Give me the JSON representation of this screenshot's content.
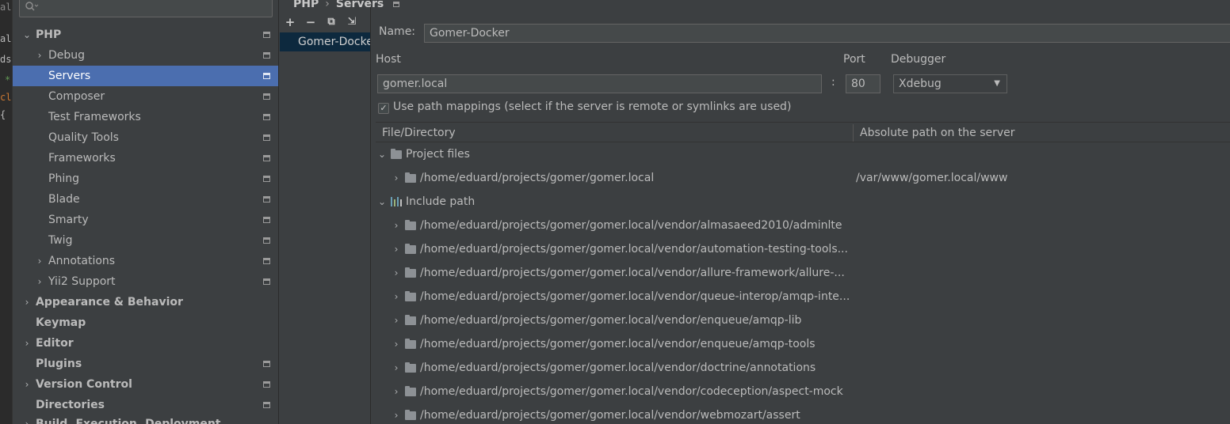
{
  "editor_strip": {
    "fragments": [
      "al",
      "ds",
      "*",
      "cl",
      "{"
    ]
  },
  "settings_tree": {
    "search_placeholder": "",
    "items": [
      {
        "label": "PHP",
        "bold": true,
        "expanded": true
      },
      {
        "label": "Debug"
      },
      {
        "label": "Servers",
        "selected": true
      },
      {
        "label": "Composer"
      },
      {
        "label": "Test Frameworks"
      },
      {
        "label": "Quality Tools"
      },
      {
        "label": "Frameworks"
      },
      {
        "label": "Phing"
      },
      {
        "label": "Blade"
      },
      {
        "label": "Smarty"
      },
      {
        "label": "Twig"
      },
      {
        "label": "Annotations"
      },
      {
        "label": "Yii2 Support"
      },
      {
        "label": "Appearance & Behavior",
        "bold": true
      },
      {
        "label": "Keymap",
        "bold": true
      },
      {
        "label": "Editor",
        "bold": true
      },
      {
        "label": "Plugins",
        "bold": true
      },
      {
        "label": "Version Control",
        "bold": true
      },
      {
        "label": "Directories",
        "bold": true
      },
      {
        "label": "Build, Execution, Deployment",
        "bold": true
      }
    ]
  },
  "breadcrumb": {
    "parent": "PHP",
    "separator": "›",
    "current": "Servers"
  },
  "servers_toolbar": {
    "add": "+",
    "remove": "−",
    "copy": "⧉",
    "import": "⇲"
  },
  "servers_list": {
    "items": [
      "Gomer-Docker"
    ]
  },
  "server_form": {
    "name_label": "Name:",
    "name_value": "Gomer-Docker",
    "host_label": "Host",
    "host_value": "gomer.local",
    "colon": ":",
    "port_label": "Port",
    "port_value": "80",
    "debugger_label": "Debugger",
    "debugger_value": "Xdebug",
    "path_mappings_label": "Use path mappings (select if the server is remote or symlinks are used)",
    "path_mappings_checked": true
  },
  "mappings_table": {
    "col_file": "File/Directory",
    "col_server": "Absolute path on the server",
    "rows": [
      {
        "label": "Project files",
        "server_path": ""
      },
      {
        "label": "/home/eduard/projects/gomer/gomer.local",
        "server_path": "/var/www/gomer.local/www"
      },
      {
        "label": "Include path",
        "server_path": ""
      },
      {
        "label": "/home/eduard/projects/gomer/gomer.local/vendor/almasaeed2010/adminlte",
        "server_path": ""
      },
      {
        "label": "/home/eduard/projects/gomer/gomer.local/vendor/automation-testing-tools...",
        "server_path": ""
      },
      {
        "label": "/home/eduard/projects/gomer/gomer.local/vendor/allure-framework/allure-...",
        "server_path": ""
      },
      {
        "label": "/home/eduard/projects/gomer/gomer.local/vendor/queue-interop/amqp-inte...",
        "server_path": ""
      },
      {
        "label": "/home/eduard/projects/gomer/gomer.local/vendor/enqueue/amqp-lib",
        "server_path": ""
      },
      {
        "label": "/home/eduard/projects/gomer/gomer.local/vendor/enqueue/amqp-tools",
        "server_path": ""
      },
      {
        "label": "/home/eduard/projects/gomer/gomer.local/vendor/doctrine/annotations",
        "server_path": ""
      },
      {
        "label": "/home/eduard/projects/gomer/gomer.local/vendor/codeception/aspect-mock",
        "server_path": ""
      },
      {
        "label": "/home/eduard/projects/gomer/gomer.local/vendor/webmozart/assert",
        "server_path": ""
      }
    ]
  },
  "colors": {
    "selection": "#4b6eaf",
    "panel": "#3c3f41",
    "editor": "#2b2b2b",
    "list_selection": "#0d293e"
  }
}
